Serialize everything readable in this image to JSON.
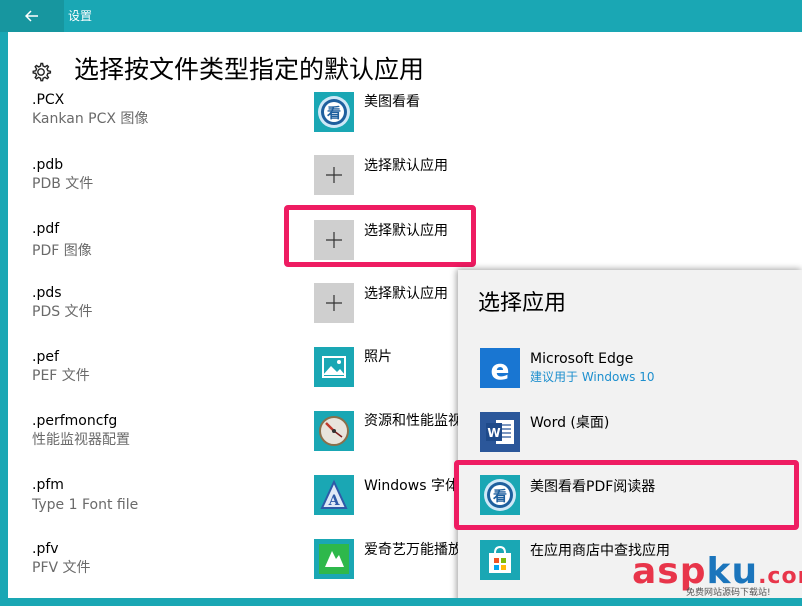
{
  "window": {
    "title": "设置"
  },
  "page": {
    "title": "选择按文件类型指定的默认应用"
  },
  "rows": [
    {
      "ext": ".PCX",
      "desc": "Kankan PCX 图像",
      "app": "美图看看",
      "icon": "meitu-kankan-icon"
    },
    {
      "ext": ".pdb",
      "desc": "PDB 文件",
      "app": "选择默认应用",
      "icon": "plus-icon"
    },
    {
      "ext": ".pdf",
      "desc": "PDF 图像",
      "app": "选择默认应用",
      "icon": "plus-icon"
    },
    {
      "ext": ".pds",
      "desc": "PDS 文件",
      "app": "选择默认应用",
      "icon": "plus-icon"
    },
    {
      "ext": ".pef",
      "desc": "PEF 文件",
      "app": "照片",
      "icon": "photos-icon"
    },
    {
      "ext": ".perfmoncfg",
      "desc": "性能监视器配置",
      "app": "资源和性能监视器",
      "icon": "perfmon-icon"
    },
    {
      "ext": ".pfm",
      "desc": "Type 1 Font file",
      "app": "Windows 字体查看器",
      "icon": "font-viewer-icon"
    },
    {
      "ext": ".pfv",
      "desc": "PFV 文件",
      "app": "爱奇艺万能播放器",
      "icon": "iqiyi-icon"
    }
  ],
  "flyout": {
    "title": "选择应用",
    "items": [
      {
        "name": "Microsoft Edge",
        "sub": "建议用于 Windows 10",
        "icon": "edge-icon"
      },
      {
        "name": "Word (桌面)",
        "icon": "word-icon"
      },
      {
        "name": "美图看看PDF阅读器",
        "icon": "meitu-kankan-icon"
      },
      {
        "name": "在应用商店中查找应用",
        "icon": "store-icon"
      }
    ]
  },
  "watermark": {
    "main_a": "asp",
    "main_b": "ku",
    "main_c": ".com",
    "sub": "免费网站源码下载站!"
  },
  "colors": {
    "accent": "#1aa7b4",
    "highlight": "#ee1c62",
    "link": "#1d8fce",
    "tile": "#cfcfcf"
  }
}
